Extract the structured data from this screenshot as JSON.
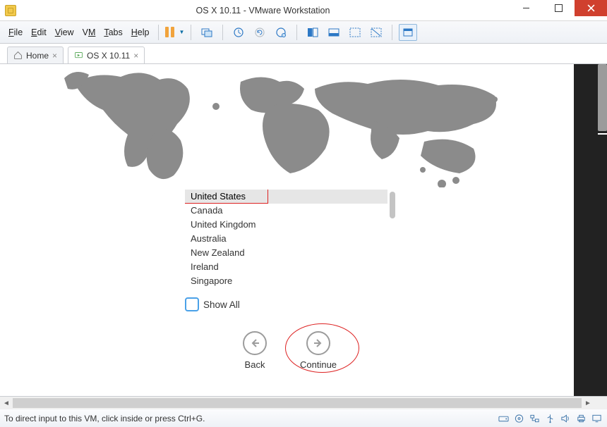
{
  "window": {
    "title": "OS X 10.11 - VMware Workstation"
  },
  "menubar": {
    "file": "File",
    "edit": "Edit",
    "view": "View",
    "vm": "VM",
    "tabs": "Tabs",
    "help": "Help"
  },
  "tabs": {
    "home": "Home",
    "active": "OS X 10.11"
  },
  "setup": {
    "countries": [
      "United States",
      "Canada",
      "United Kingdom",
      "Australia",
      "New Zealand",
      "Ireland",
      "Singapore"
    ],
    "selected_index": 0,
    "show_all_label": "Show All",
    "back_label": "Back",
    "continue_label": "Continue"
  },
  "statusbar": {
    "message": "To direct input to this VM, click inside or press Ctrl+G."
  }
}
